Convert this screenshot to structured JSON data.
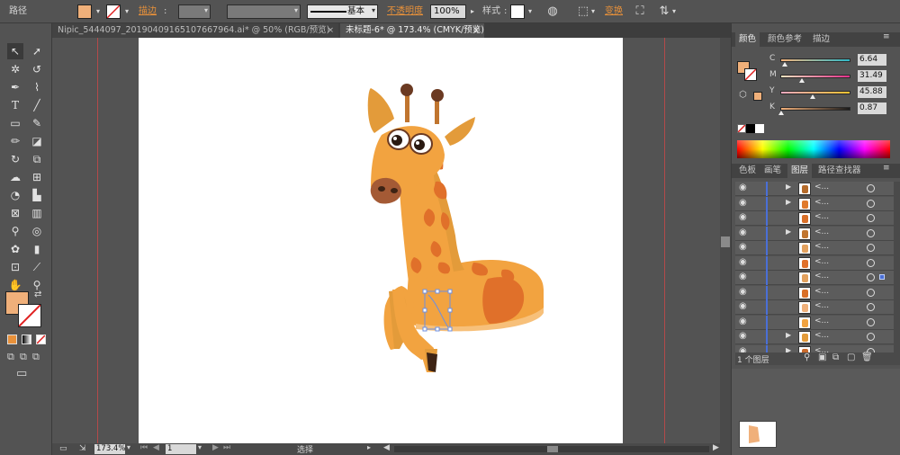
{
  "control_bar": {
    "object_type": "路径",
    "stroke_label": "描边",
    "stroke_profile": "基本",
    "opacity_label": "不透明度",
    "opacity_value": "100%",
    "style_label": "样式",
    "transform_label": "变换",
    "fill_color": "#f0b07a"
  },
  "tabs": [
    {
      "label": "Nipic_5444097_20190409165107667964.ai* @ 50% (RGB/预览)",
      "close": "×"
    },
    {
      "label": "未标题-6* @ 173.4% (CMYK/预览)",
      "close": "×"
    }
  ],
  "toolbox": {
    "tools": [
      "selection-tool",
      "direct-selection-tool",
      "magic-wand-tool",
      "lasso-tool",
      "pen-tool",
      "curvature-tool",
      "type-tool",
      "line-tool",
      "rectangle-tool",
      "paintbrush-tool",
      "pencil-tool",
      "eraser-tool",
      "rotate-tool",
      "scale-tool",
      "warp-tool",
      "free-transform-tool",
      "shape-builder-tool",
      "perspective-tool",
      "mesh-tool",
      "gradient-tool",
      "eyedropper-tool",
      "blend-tool",
      "symbol-sprayer-tool",
      "column-graph-tool",
      "artboard-tool",
      "slice-tool",
      "hand-tool",
      "zoom-tool"
    ],
    "fill_color": "#f0b07a"
  },
  "status_bar": {
    "zoom": "173.4%",
    "artboard_number": "1",
    "tool_name": "选择"
  },
  "color_panel": {
    "tabs": [
      "颜色",
      "颜色参考",
      "描边"
    ],
    "fill_color": "#f0b07a",
    "channels": [
      {
        "label": "C",
        "value": "6.64",
        "fraction": 0.07
      },
      {
        "label": "M",
        "value": "31.49",
        "fraction": 0.31
      },
      {
        "label": "Y",
        "value": "45.88",
        "fraction": 0.46
      },
      {
        "label": "K",
        "value": "0.87",
        "fraction": 0.01
      }
    ]
  },
  "layers_panel": {
    "tabs": [
      "色板",
      "画笔",
      "图层",
      "路径查找器"
    ],
    "rows": [
      {
        "name": "<...",
        "expandable": true,
        "thumb_color": "#b56b2a"
      },
      {
        "name": "<...",
        "expandable": true,
        "thumb_color": "#e07a2c"
      },
      {
        "name": "<...",
        "expandable": false,
        "thumb_color": "#d96f28"
      },
      {
        "name": "<...",
        "expandable": true,
        "thumb_color": "#c0752f"
      },
      {
        "name": "<...",
        "expandable": false,
        "thumb_color": "#e3a15e"
      },
      {
        "name": "<...",
        "expandable": false,
        "thumb_color": "#e0702a"
      },
      {
        "name": "<...",
        "expandable": false,
        "thumb_color": "#e3a15e",
        "selected": true
      },
      {
        "name": "<...",
        "expandable": false,
        "thumb_color": "#d96f28"
      },
      {
        "name": "<...",
        "expandable": false,
        "thumb_color": "#f0b07a"
      },
      {
        "name": "<...",
        "expandable": false,
        "thumb_color": "#f2a340"
      },
      {
        "name": "<...",
        "expandable": true,
        "thumb_color": "#e39b3a"
      },
      {
        "name": "<...",
        "expandable": true,
        "thumb_color": "#c96a2b"
      }
    ],
    "footer_label": "1 个图层"
  }
}
